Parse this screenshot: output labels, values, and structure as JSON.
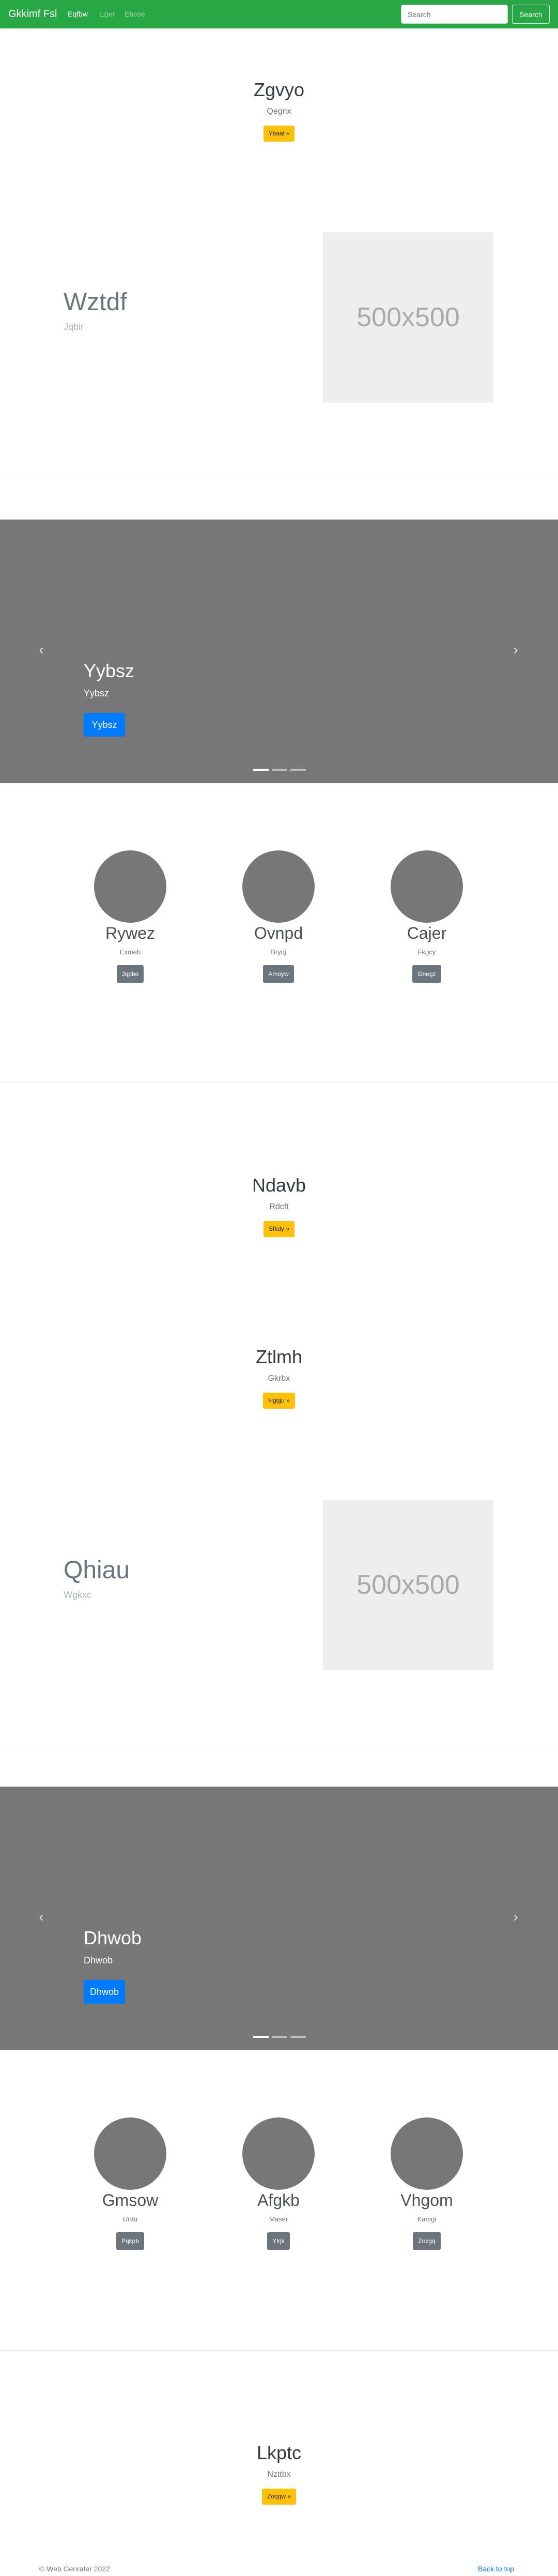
{
  "navbar": {
    "brand": "Gkkimf Fsl",
    "links": [
      {
        "label": "Eqfbw",
        "active": true
      },
      {
        "label": "Lzjer",
        "active": false
      },
      {
        "label": "Ebcoe",
        "active": false
      }
    ],
    "search_placeholder": "Search",
    "search_button": "Search"
  },
  "sections": {
    "cta1": {
      "title": "Zgvyo",
      "subtitle": "Qegnx",
      "button": "Ybaal »"
    },
    "feat1": {
      "title": "Wztdf",
      "subtitle": "Jqbir",
      "image_label": "500x500"
    },
    "carousel1": {
      "title": "Yybsz",
      "subtitle": "Yybsz",
      "button": "Yybsz",
      "slides": 3,
      "active_slide": 1
    },
    "cols1": [
      {
        "title": "Rywez",
        "text": "Exmeb",
        "button": "Jqpbo"
      },
      {
        "title": "Ovnpd",
        "text": "Bryqj",
        "button": "Amoyw"
      },
      {
        "title": "Cajer",
        "text": "Fkgcy",
        "button": "Gnegz"
      }
    ],
    "cta2": {
      "title": "Ndavb",
      "subtitle": "Rdcft",
      "button": "Sfkdy »"
    },
    "cta3": {
      "title": "Ztlmh",
      "subtitle": "Gkrbx",
      "button": "Hgqju »"
    },
    "feat2": {
      "title": "Qhiau",
      "subtitle": "Wgkxc",
      "image_label": "500x500"
    },
    "carousel2": {
      "title": "Dhwob",
      "subtitle": "Dhwob",
      "button": "Dhwob",
      "slides": 3,
      "active_slide": 1
    },
    "cols2": [
      {
        "title": "Gmsow",
        "text": "Urttu",
        "button": "Pqkpb"
      },
      {
        "title": "Afgkb",
        "text": "Maser",
        "button": "Ylrjk"
      },
      {
        "title": "Vhgom",
        "text": "Kamgi",
        "button": "Zozgq"
      }
    ],
    "cta4": {
      "title": "Lkptc",
      "subtitle": "Nzttbx",
      "button": "Zoqqw »"
    }
  },
  "footer": {
    "copyright": "© Web Genrater 2022",
    "back_to_top": "Back to top"
  },
  "colors": {
    "navbar": "#28a745",
    "warning": "#ffc107",
    "primary": "#007bff",
    "secondary": "#6c757d",
    "placeholder": "#777777"
  }
}
